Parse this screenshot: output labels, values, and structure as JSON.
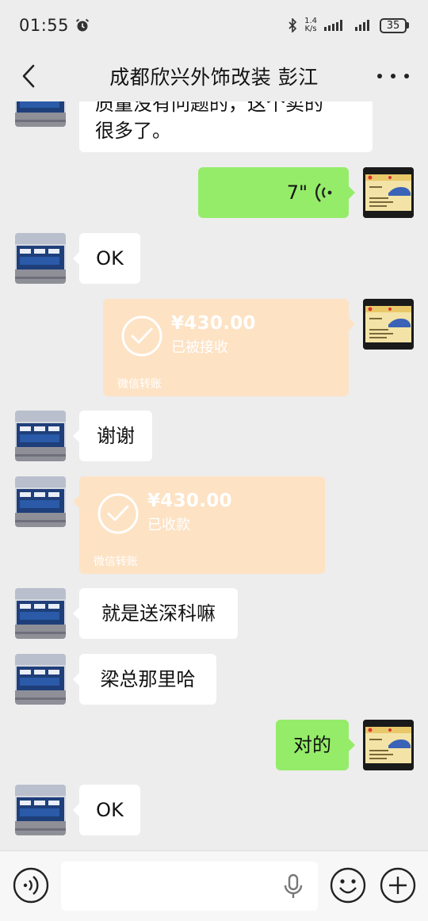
{
  "status": {
    "time": "01:55",
    "net_speed_value": "1.4",
    "net_speed_unit": "K/s",
    "battery": "35"
  },
  "nav": {
    "title": "成都欣兴外饰改装  彭江"
  },
  "messages": {
    "m0": {
      "line1": "质量没有问题的，这个卖的",
      "line2": "很多了。"
    },
    "m1": {
      "duration": "7\""
    },
    "m2": {
      "text": "OK"
    },
    "m3": {
      "amount": "¥430.00",
      "status": "已被接收",
      "label": "微信转账"
    },
    "m4": {
      "text": "谢谢"
    },
    "m5": {
      "amount": "¥430.00",
      "status": "已收款",
      "label": "微信转账"
    },
    "m6": {
      "text": "就是送深科嘛"
    },
    "m7": {
      "text": "梁总那里哈"
    },
    "m8": {
      "text": "对的"
    },
    "m9": {
      "text": "OK"
    }
  },
  "colors": {
    "self_bubble": "#95ec69",
    "other_bubble": "#ffffff",
    "transfer": "#fde2c4",
    "background": "#ededed"
  },
  "icons": [
    "alarm-icon",
    "bluetooth-icon",
    "signal-icon",
    "battery-icon",
    "back-icon",
    "more-icon",
    "voice-wave-icon",
    "check-circle-icon",
    "voice-mode-icon",
    "microphone-icon",
    "emoji-icon",
    "plus-icon"
  ]
}
